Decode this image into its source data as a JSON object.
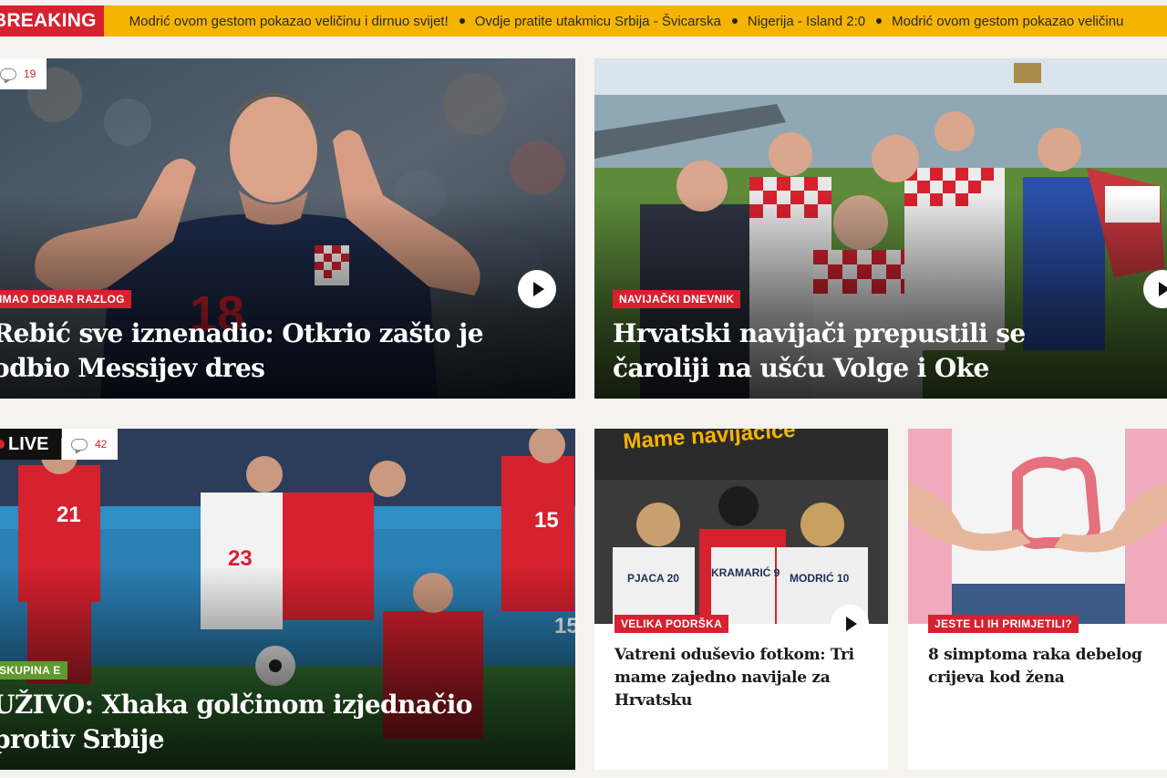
{
  "ticker": {
    "badge": "BREAKING",
    "items": [
      "Modrić ovom gestom pokazao veličinu i dirnuo svijet!",
      "Ovdje pratite utakmicu Srbija - Švicarska",
      "Nigerija - Island 2:0",
      "Modrić ovom gestom pokazao veličinu"
    ]
  },
  "articles": {
    "rebic": {
      "comment_count": "19",
      "tag": "IMAO DOBAR RAZLOG",
      "title": "Rebić sve iznenadio: Otkrio zašto je odbio Messijev dres",
      "photo_alt": "Ante Rebić in Croatia jersey number 18 cupping ears",
      "jersey_number": "18"
    },
    "navijaci": {
      "tag": "NAVIJAČKI DNEVNIK",
      "title": "Hrvatski navijači prepustili se čaroliji na ušću Volge i Oke",
      "photo_alt": "Croatian fans in checkered shirts by the river"
    },
    "xhaka": {
      "live_label": "LIVE",
      "comment_count": "42",
      "tag": "SKUPINA E",
      "title": "UŽIVO: Xhaka golčinom izjednačio protiv Srbije",
      "photo_alt": "Serbia vs Switzerland match action",
      "numbers": [
        "21",
        "23",
        "15",
        "15"
      ]
    },
    "mame": {
      "banner_text": "Mame navijačice",
      "tag": "VELIKA PODRŠKA",
      "title": "Vatreni oduševio fotkom: Tri mame zajedno navijale za Hrvatsku",
      "shirts": [
        "PJACA 20",
        "KRAMARIĆ 9",
        "MODRIĆ 10"
      ]
    },
    "simptomi": {
      "tag": "JESTE LI IH PRIMJETILI?",
      "title": "8 simptoma raka debelog crijeva kod žena"
    }
  },
  "colors": {
    "ticker_bg": "#f5b400",
    "brand_red": "#d6212e",
    "tag_green": "#5f9a2c",
    "page_bg": "#f4f3f0"
  }
}
